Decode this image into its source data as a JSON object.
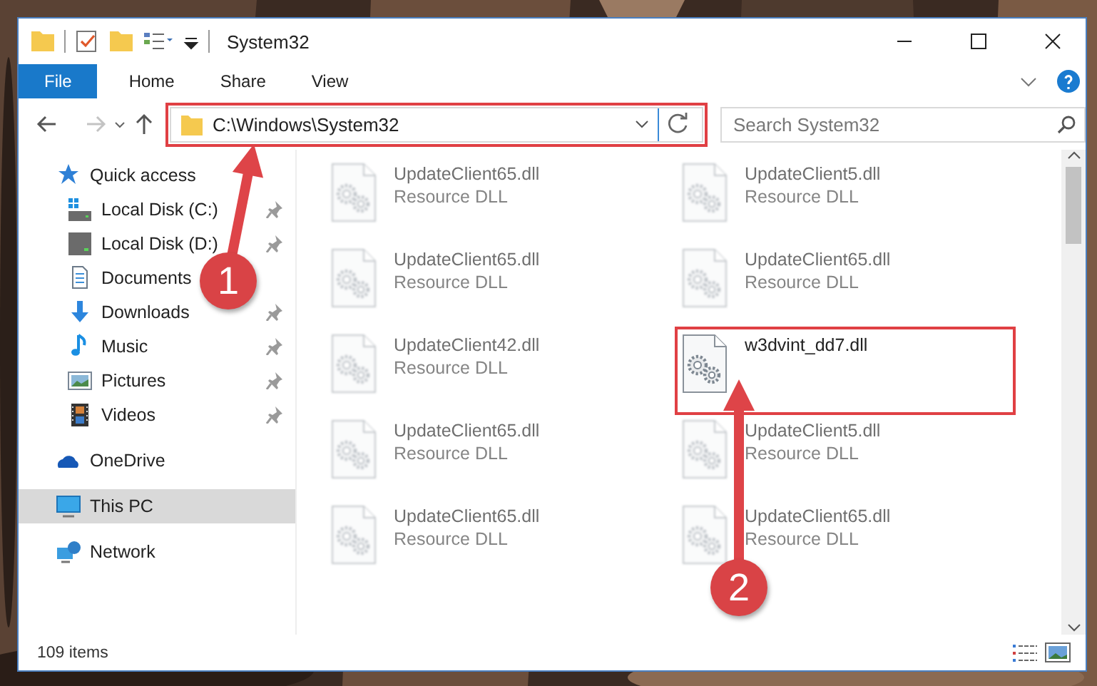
{
  "window": {
    "title": "System32"
  },
  "ribbon_tabs": [
    {
      "label": "File",
      "kind": "file"
    },
    {
      "label": "Home",
      "kind": "tab"
    },
    {
      "label": "Share",
      "kind": "tab"
    },
    {
      "label": "View",
      "kind": "tab"
    }
  ],
  "address_bar": {
    "path": "C:\\Windows\\System32",
    "highlighted": true
  },
  "search": {
    "placeholder": "Search System32"
  },
  "sidebar": {
    "items": [
      {
        "label": "Quick access",
        "kind": "star",
        "pinned": false,
        "selected": false,
        "children": [
          {
            "label": "Local Disk (C:)",
            "kind": "system-drive",
            "pinned": true,
            "selected": false
          },
          {
            "label": "Local Disk (D:)",
            "kind": "drive",
            "pinned": true,
            "selected": false
          },
          {
            "label": "Documents",
            "kind": "document",
            "pinned": false,
            "selected": false
          },
          {
            "label": "Downloads",
            "kind": "download",
            "pinned": true,
            "selected": false
          },
          {
            "label": "Music",
            "kind": "music",
            "pinned": true,
            "selected": false
          },
          {
            "label": "Pictures",
            "kind": "pictures",
            "pinned": true,
            "selected": false
          },
          {
            "label": "Videos",
            "kind": "videos",
            "pinned": true,
            "selected": false
          }
        ]
      },
      {
        "label": "OneDrive",
        "kind": "cloud",
        "pinned": false,
        "selected": false
      },
      {
        "label": "This PC",
        "kind": "pc",
        "pinned": false,
        "selected": true
      },
      {
        "label": "Network",
        "kind": "network",
        "pinned": false,
        "selected": false
      }
    ]
  },
  "files": [
    {
      "name": "UpdateClient65.dll",
      "type": "Resource DLL",
      "blurred": true,
      "highlighted": false
    },
    {
      "name": "UpdateClient5.dll",
      "type": "Resource DLL",
      "blurred": true,
      "highlighted": false
    },
    {
      "name": "UpdateClient65.dll",
      "type": "Resource DLL",
      "blurred": true,
      "highlighted": false
    },
    {
      "name": "UpdateClient65.dll",
      "type": "Resource DLL",
      "blurred": true,
      "highlighted": false
    },
    {
      "name": "UpdateClient42.dll",
      "type": "Resource DLL",
      "blurred": true,
      "highlighted": false
    },
    {
      "name": "w3dvint_dd7.dll",
      "blurred": false,
      "highlighted": true
    },
    {
      "name": "UpdateClient65.dll",
      "type": "Resource DLL",
      "blurred": true,
      "highlighted": false
    },
    {
      "name": "UpdateClient5.dll",
      "type": "Resource DLL",
      "blurred": true,
      "highlighted": false
    },
    {
      "name": "UpdateClient65.dll",
      "type": "Resource DLL",
      "blurred": true,
      "highlighted": false
    },
    {
      "name": "UpdateClient65.dll",
      "type": "Resource DLL",
      "blurred": true,
      "highlighted": false
    }
  ],
  "status_bar": {
    "item_count": "109 items"
  },
  "annotations": [
    {
      "label": "1"
    },
    {
      "label": "2"
    }
  ]
}
